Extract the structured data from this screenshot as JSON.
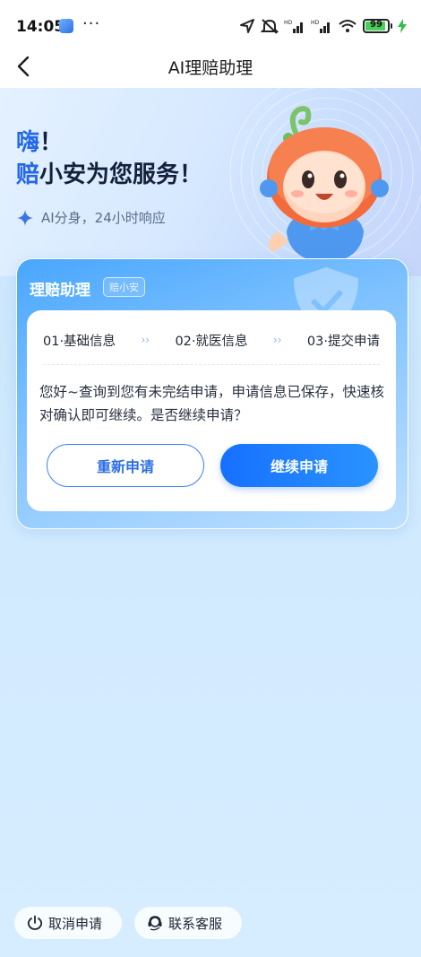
{
  "status_bar": {
    "time": "14:05",
    "more": "···",
    "battery": "99"
  },
  "nav": {
    "title": "AI理赔助理"
  },
  "hero": {
    "greeting_line1_highlight": "嗨",
    "greeting_line1_rest": "！",
    "greeting_line2_highlight": "赔",
    "greeting_line2_rest": "小安为您服务！",
    "subtitle": "AI分身，24小时响应",
    "accent_color": "#2468e8"
  },
  "card": {
    "title": "理赔助理",
    "tag": "赔小安",
    "steps": [
      {
        "label": "01·基础信息"
      },
      {
        "label": "02·就医信息"
      },
      {
        "label": "03·提交申请"
      }
    ],
    "message": "您好~查询到您有未完结申请，申请信息已保存，快速核对确认即可继续。是否继续申请？",
    "restart_button": "重新申请",
    "continue_button": "继续申请"
  },
  "bottom": {
    "cancel_label": "取消申请",
    "contact_label": "联系客服"
  }
}
